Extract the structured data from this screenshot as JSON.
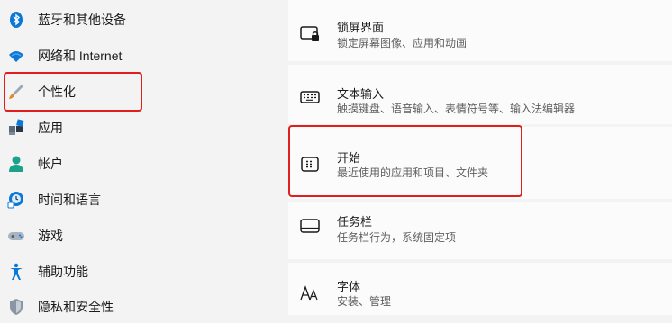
{
  "sidebar": {
    "items": [
      {
        "label": "蓝牙和其他设备",
        "icon": "bluetooth-icon"
      },
      {
        "label": "网络和 Internet",
        "icon": "wifi-icon"
      },
      {
        "label": "个性化",
        "icon": "paintbrush-icon"
      },
      {
        "label": "应用",
        "icon": "apps-icon"
      },
      {
        "label": "帐户",
        "icon": "account-icon"
      },
      {
        "label": "时间和语言",
        "icon": "time-language-icon"
      },
      {
        "label": "游戏",
        "icon": "gamepad-icon"
      },
      {
        "label": "辅助功能",
        "icon": "accessibility-icon"
      },
      {
        "label": "隐私和安全性",
        "icon": "shield-icon"
      }
    ]
  },
  "main": {
    "cards": [
      {
        "title": "锁屏界面",
        "subtitle": "锁定屏幕图像、应用和动画",
        "icon": "lockscreen-icon"
      },
      {
        "title": "文本输入",
        "subtitle": "触摸键盘、语音输入、表情符号等、输入法编辑器",
        "icon": "keyboard-icon"
      },
      {
        "title": "开始",
        "subtitle": "最近使用的应用和项目、文件夹",
        "icon": "start-icon"
      },
      {
        "title": "任务栏",
        "subtitle": "任务栏行为，系统固定项",
        "icon": "taskbar-icon"
      },
      {
        "title": "字体",
        "subtitle": "安装、管理",
        "icon": "font-icon"
      }
    ]
  },
  "colors": {
    "accent": "#0067c0",
    "highlight": "#e01e1e"
  }
}
